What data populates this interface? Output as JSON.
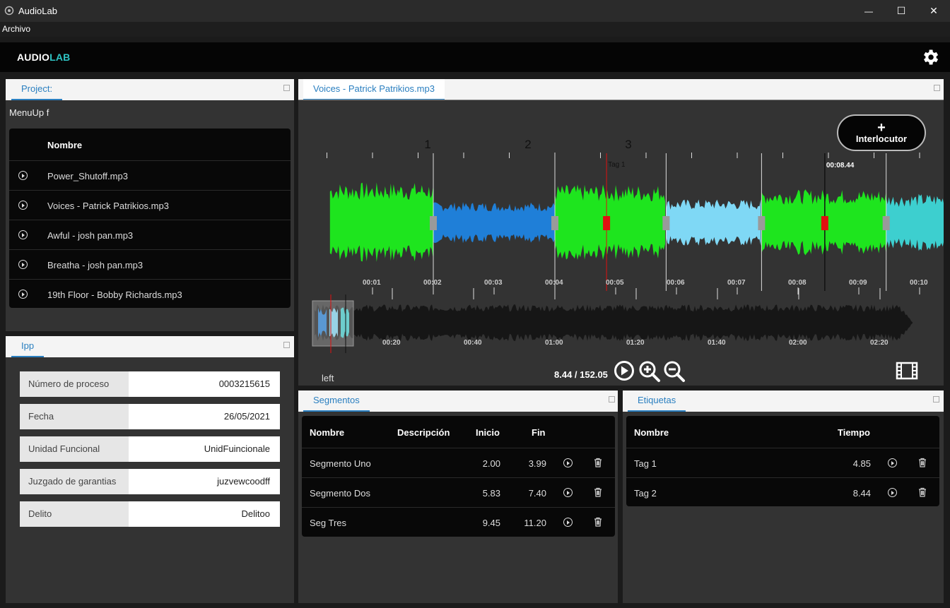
{
  "window": {
    "title": "AudioLab",
    "minimize": "—",
    "maximize": "☐",
    "close": "✕"
  },
  "menu": {
    "archivo": "Archivo"
  },
  "brand": {
    "part1": "AUDIO",
    "part2": "LAB",
    "accent": "#2ec4c4"
  },
  "project": {
    "tab": "Project:",
    "menu_label": "MenuUp f",
    "header": "Nombre",
    "files": [
      "Power_Shutoff.mp3",
      "Voices - Patrick Patrikios.mp3",
      "Awful - josh pan.mp3",
      "Breatha - josh pan.mp3",
      "19th Floor - Bobby Richards.mp3"
    ]
  },
  "ipp": {
    "tab": "Ipp",
    "fields": [
      {
        "label": "Número de proceso",
        "value": "0003215615"
      },
      {
        "label": "Fecha",
        "value": "26/05/2021"
      },
      {
        "label": "Unidad Funcional",
        "value": "UnidFuincionale"
      },
      {
        "label": "Juzgado de garantias",
        "value": "juzvewcoodff"
      },
      {
        "label": "Delito",
        "value": "Delitoo"
      }
    ]
  },
  "player": {
    "tab": "Voices - Patrick Patrikios.mp3",
    "segment_numbers": [
      "1",
      "2",
      "3"
    ],
    "interlocutor_plus": "+",
    "interlocutor_label": "Interlocutor",
    "tag_label": "Tag 1",
    "cursor_time": "00:08.44",
    "timeline_ticks": [
      "00:01",
      "00:02",
      "00:03",
      "00:04",
      "00:05",
      "00:06",
      "00:07",
      "00:08",
      "00:09",
      "00:10"
    ],
    "overview_ticks": [
      "00:20",
      "00:40",
      "01:00",
      "01:20",
      "01:40",
      "02:00",
      "02:20"
    ],
    "left_label": "left",
    "time_display": "8.44 / 152.05",
    "colors": {
      "green": "#1ee51e",
      "blue": "#1f7fd8",
      "lightblue": "#7fd8f5",
      "teal": "#3dcfcf",
      "marker_red": "#e01010",
      "handle_gray": "#9a9a9a"
    }
  },
  "segmentos": {
    "tab": "Segmentos",
    "headers": {
      "nombre": "Nombre",
      "descripcion": "Descripción",
      "inicio": "Inicio",
      "fin": "Fin"
    },
    "rows": [
      {
        "nombre": "Segmento Uno",
        "descripcion": "",
        "inicio": "2.00",
        "fin": "3.99"
      },
      {
        "nombre": "Segmento Dos",
        "descripcion": "",
        "inicio": "5.83",
        "fin": "7.40"
      },
      {
        "nombre": "Seg Tres",
        "descripcion": "",
        "inicio": "9.45",
        "fin": "11.20"
      }
    ]
  },
  "etiquetas": {
    "tab": "Etiquetas",
    "headers": {
      "nombre": "Nombre",
      "tiempo": "Tiempo"
    },
    "rows": [
      {
        "nombre": "Tag 1",
        "tiempo": "4.85"
      },
      {
        "nombre": "Tag 2",
        "tiempo": "8.44"
      }
    ]
  }
}
